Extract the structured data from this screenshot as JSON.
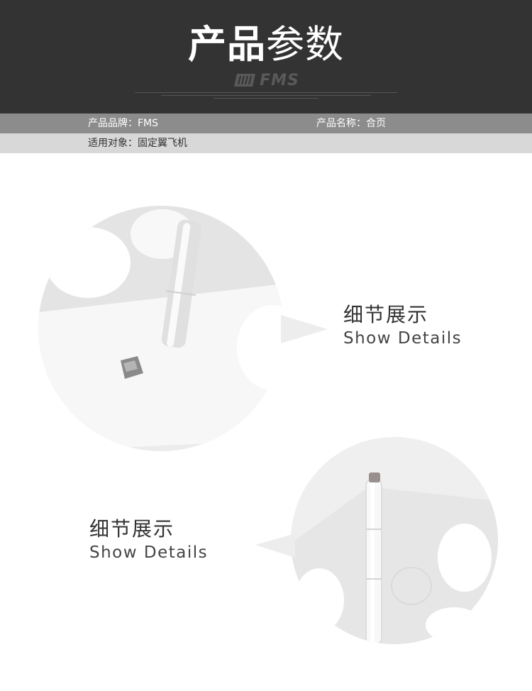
{
  "header": {
    "title_bold": "产品",
    "title_light": "参数",
    "brand_logo_text": "FMS"
  },
  "specs": {
    "brand": "产品品牌：FMS",
    "name": "产品名称：合页",
    "target": "适用对象：固定翼飞机"
  },
  "details": [
    {
      "zh": "细节展示",
      "en": "Show Details"
    },
    {
      "zh": "细节展示",
      "en": "Show Details"
    }
  ],
  "colors": {
    "header_bg": "#333333",
    "spec_row1_bg": "#8c8c8c",
    "spec_row2_bg": "#d8d8d8"
  },
  "icons": [
    "fms-logo-icon"
  ]
}
